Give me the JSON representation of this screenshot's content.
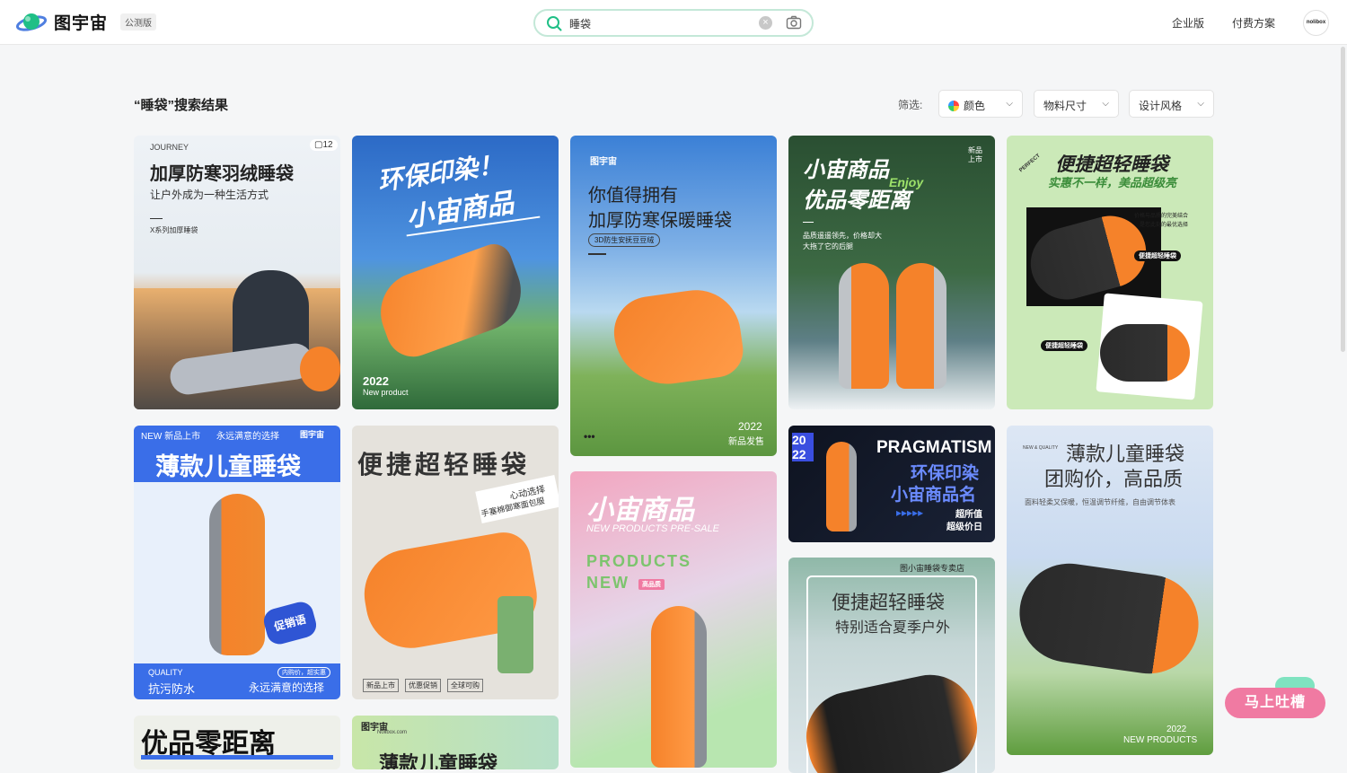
{
  "header": {
    "logo_text": "图宇宙",
    "logo_badge": "公测版",
    "search_value": "睡袋",
    "links": [
      "企业版",
      "付费方案"
    ],
    "avatar_text": "nolibox"
  },
  "results": {
    "title": "“睡袋”搜索结果",
    "filter_label": "筛选:",
    "filters": [
      "颜色",
      "物料尺寸",
      "设计风格"
    ]
  },
  "cards": {
    "c1": {
      "small": "JOURNEY",
      "count": "12",
      "title": "加厚防寒羽绒睡袋",
      "subtitle": "让户外成为一种生活方式",
      "note": "X系列加厚睡袋"
    },
    "c2": {
      "line1": "环保印染！",
      "line2": "小宙商品",
      "year": "2022",
      "sub": "New product"
    },
    "c3": {
      "brand": "图宇宙",
      "line1": "你值得拥有",
      "line2": "加厚防寒保暖睡袋",
      "tag": "3D防生安抚豆豆绒",
      "year": "2022",
      "sub": "新品发售"
    },
    "c4": {
      "line1": "小宙商品",
      "line2": "优品零距离",
      "corner": "新品上市",
      "enjoy": "Enjoy",
      "desc1": "品质遥遥领先，价格却大",
      "desc2": "大拖了它的后腿"
    },
    "c5": {
      "title": "便捷超轻睡袋",
      "sub": "实惠不一样，美品超级亮",
      "badge": "便捷超轻睡袋",
      "note1": "价格与品质的完美结合",
      "note2": "是您此刻的最优选择",
      "perfect": "PERFECT"
    },
    "c6": {
      "top1": "NEW 新品上市",
      "top2": "永远满意的选择",
      "brand": "图宇宙",
      "title": "薄款儿童睡袋",
      "promo": "促销语",
      "q": "QUALITY",
      "bottom1": "抗污防水",
      "bottom2": "永远满意的选择",
      "pill": "内购价，超实惠"
    },
    "c7": {
      "title": "便捷超轻睡袋",
      "side1": "心动选择",
      "side2": "手塞棉御寒面包服",
      "tags": [
        "新品上市",
        "优惠促销",
        "全球可购"
      ]
    },
    "c8": {
      "title": "小宙商品",
      "sub": "NEW PRODUCTS PRE-SALE",
      "p1": "PRODUCTS",
      "p2": "NEW",
      "badge": "高品质"
    },
    "c9": {
      "year": "20 22",
      "line1": "PRAGMATISM",
      "line2": "环保印染",
      "line3": "小宙商品名",
      "p1": "超所值",
      "p2": "超级价日"
    },
    "c10": {
      "store": "图小宙睡袋专卖店",
      "line1": "便捷超轻睡袋",
      "line2": "特别适合夏季户外"
    },
    "c11": {
      "line1": "薄款儿童睡袋",
      "line2": "团购价，高品质",
      "desc": "面料轻柔又保暖，恒温调节纤维，自由调节体表",
      "newq": "NEW & QUALITY",
      "year": "2022",
      "sub": "NEW PRODUCTS"
    },
    "c12": {
      "title": "优品零距离"
    },
    "c13": {
      "brand": "图宇宙",
      "sub": "Nolibox.com",
      "title": "薄款儿童睡袋"
    }
  },
  "feedback": {
    "label": "马上吐槽"
  },
  "colors": {
    "accent_green": "#1fbf86",
    "feedback_pink": "#f07aa2",
    "orange": "#f5822a"
  }
}
